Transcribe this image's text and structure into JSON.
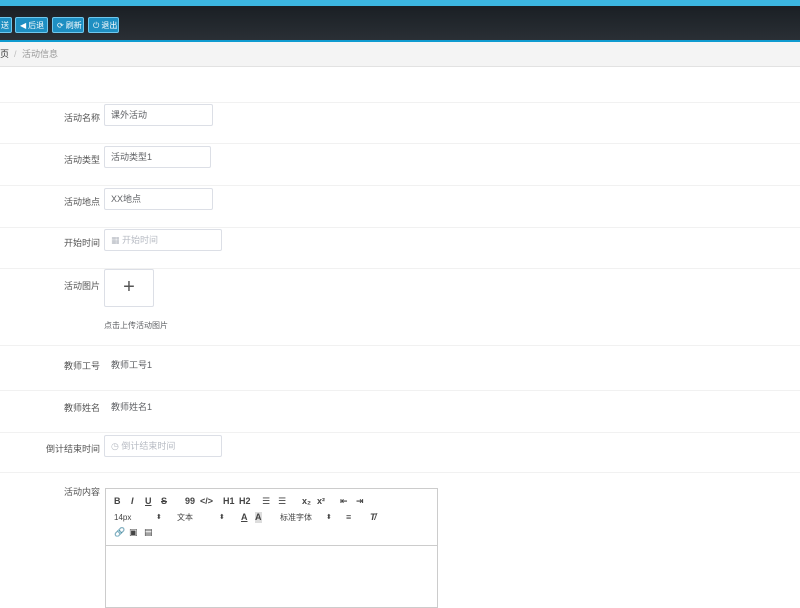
{
  "toolbar": {
    "buttons": [
      {
        "icon": "save-icon",
        "label": "保存"
      },
      {
        "icon": "back-icon",
        "label": "后退"
      },
      {
        "icon": "refresh-icon",
        "label": "刷新"
      },
      {
        "icon": "power-icon",
        "label": "退出"
      }
    ],
    "save_label_visible": "送"
  },
  "breadcrumb": {
    "home": "页",
    "separator": "/",
    "current": "活动信息"
  },
  "form": {
    "name": {
      "label": "活动名称",
      "value": "课外活动"
    },
    "type": {
      "label": "活动类型",
      "value": "活动类型1"
    },
    "place": {
      "label": "活动地点",
      "value": "XX地点"
    },
    "start": {
      "label": "开始时间",
      "placeholder": "开始时间"
    },
    "image": {
      "label": "活动图片",
      "upload_symbol": "+",
      "tip": "点击上传活动图片"
    },
    "teacher_no": {
      "label": "教师工号",
      "value": "教师工号1"
    },
    "teacher_name": {
      "label": "教师姓名",
      "value": "教师姓名1"
    },
    "countdown": {
      "label": "倒计结束时间",
      "placeholder": "倒计结束时间"
    },
    "content": {
      "label": "活动内容"
    }
  },
  "editor": {
    "row1": [
      "B",
      "I",
      "U",
      "S",
      "99",
      "</>",
      "H1",
      "H2",
      "list-ordered",
      "list-bullet",
      "x2sub",
      "x2sup",
      "outdent",
      "indent"
    ],
    "size": "14px",
    "text": "文本",
    "font": "标准字体"
  },
  "colors": {
    "accent": "#3cb6e1",
    "topbar": "#1f2429",
    "button": "#1e8fc2"
  }
}
